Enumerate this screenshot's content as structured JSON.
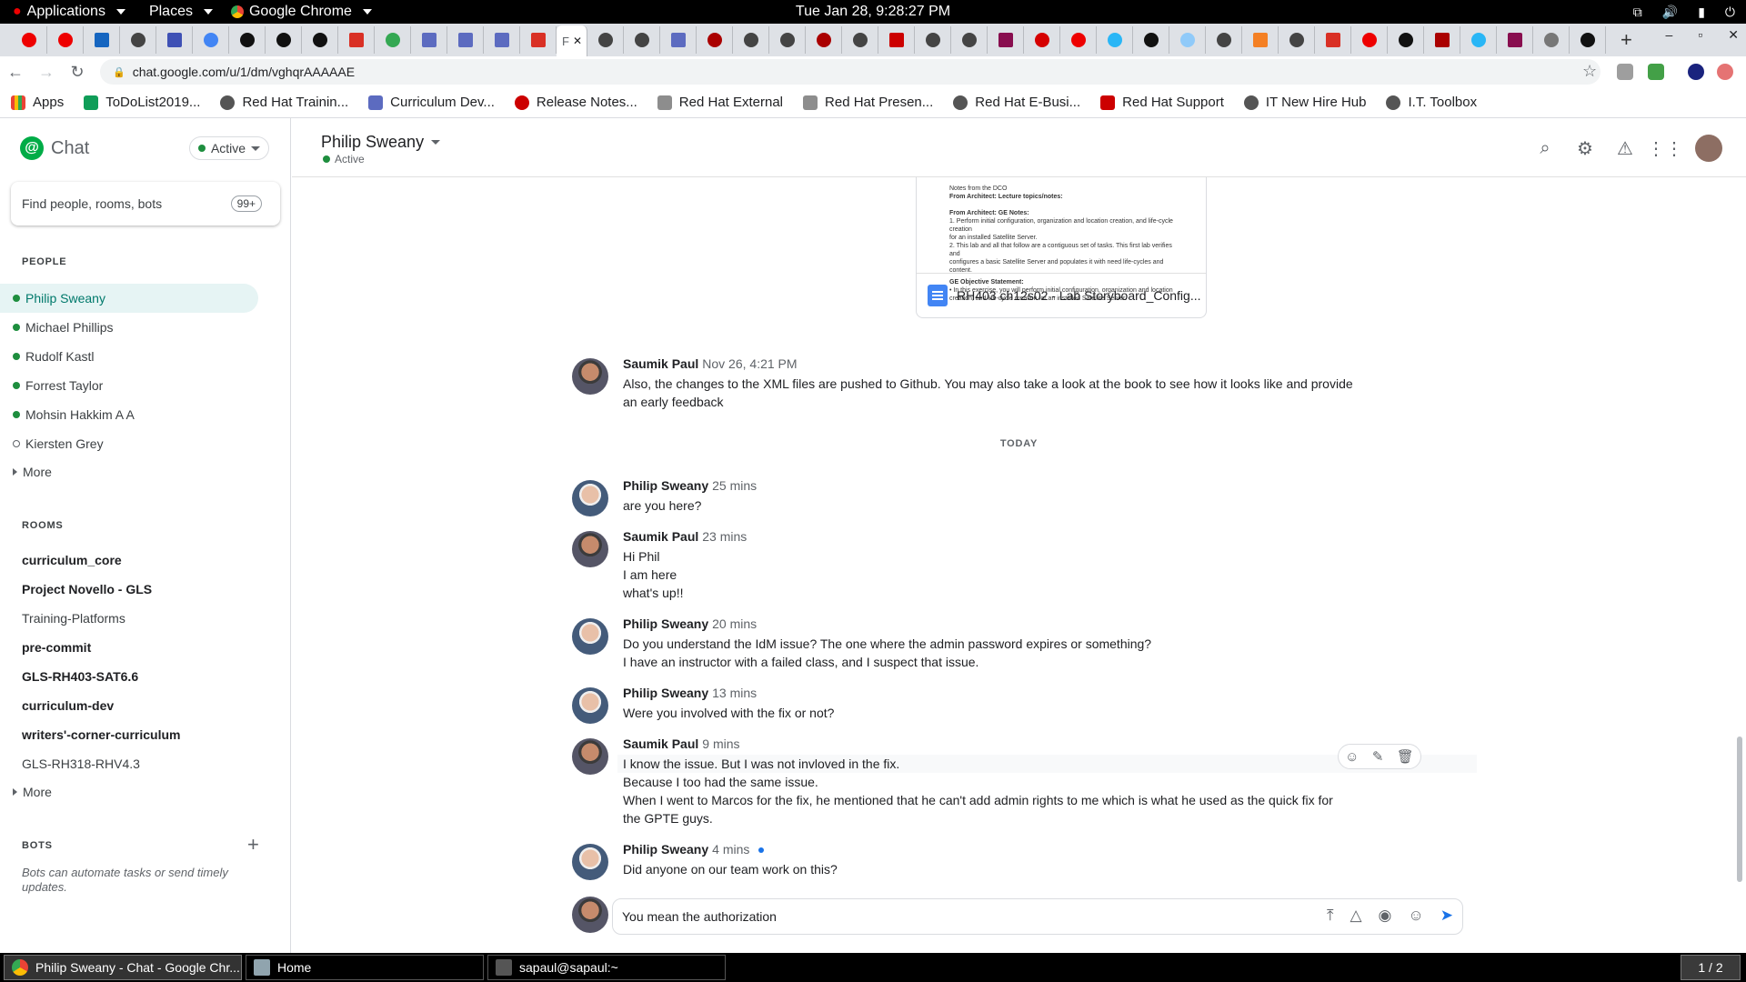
{
  "gnome": {
    "applications": "Applications",
    "places": "Places",
    "browser": "Google Chrome",
    "clock": "Tue Jan 28,  9:28:27 PM"
  },
  "browser": {
    "active_tab_label": "F",
    "url": "chat.google.com/u/1/dm/vghqrAAAAAE",
    "bookmarks": [
      {
        "label": "Apps",
        "color": "#ea4335"
      },
      {
        "label": "ToDoList2019...",
        "color": "#0f9d58"
      },
      {
        "label": "Red Hat Trainin...",
        "color": "#555555"
      },
      {
        "label": "Curriculum Dev...",
        "color": "#5c6bc0"
      },
      {
        "label": "Release Notes...",
        "color": "#cc0000"
      },
      {
        "label": "Red Hat External",
        "color": "#8d8d8d"
      },
      {
        "label": "Red Hat Presen...",
        "color": "#8d8d8d"
      },
      {
        "label": "Red Hat E-Busi...",
        "color": "#555555"
      },
      {
        "label": "Red Hat Support",
        "color": "#cc0000"
      },
      {
        "label": "IT New Hire Hub",
        "color": "#555555"
      },
      {
        "label": "I.T. Toolbox",
        "color": "#555555"
      }
    ]
  },
  "sidebar": {
    "app_name": "Chat",
    "status": "Active",
    "search_placeholder": "Find people, rooms, bots",
    "unread_badge": "99+",
    "people_header": "PEOPLE",
    "people": [
      {
        "name": "Philip Sweany",
        "online": true
      },
      {
        "name": "Michael Phillips",
        "online": true
      },
      {
        "name": "Rudolf Kastl",
        "online": true
      },
      {
        "name": "Forrest Taylor",
        "online": true
      },
      {
        "name": "Mohsin Hakkim A A",
        "online": true
      },
      {
        "name": "Kiersten Grey",
        "online": false
      }
    ],
    "more_people": "More",
    "rooms_header": "ROOMS",
    "rooms": [
      {
        "name": "curriculum_core",
        "unread": true
      },
      {
        "name": "Project Novello - GLS",
        "unread": true
      },
      {
        "name": "Training-Platforms",
        "unread": false
      },
      {
        "name": "pre-commit",
        "unread": true
      },
      {
        "name": "GLS-RH403-SAT6.6",
        "unread": true
      },
      {
        "name": "curriculum-dev",
        "unread": true
      },
      {
        "name": "writers'-corner-curriculum",
        "unread": true
      },
      {
        "name": "GLS-RH318-RHV4.3",
        "unread": false
      }
    ],
    "more_rooms": "More",
    "bots_header": "BOTS",
    "bots_hint": "Bots can automate tasks or send timely updates."
  },
  "conversation": {
    "title": "Philip Sweany",
    "status": "Active",
    "attachment": {
      "name": "RH403 ch12s02 - Lab Storyboard_Config...",
      "preview_lines": [
        "Notes from the DCO",
        "From Architect: Lecture topics/notes:",
        "",
        "From Architect: GE Notes:",
        "1. Perform initial configuration, organization and location creation, and life-cycle creation",
        "   for an installed Satellite Server.",
        "2. This lab and all that follow are a contiguous set of tasks. This first lab verifies and",
        "   configures a basic Satellite Server and populates it with need life-cycles and content.",
        "",
        "GE Objective Statement:",
        "• In this exercise, you will perform initial configuration, organization and location",
        "  creation, and life-cycle creation for an installed Satellite Server."
      ]
    },
    "today_divider": "TODAY",
    "messages": [
      {
        "author": "Saumik Paul",
        "time": "Nov 26, 4:21 PM",
        "lines": [
          "Also, the changes to the XML files are pushed to Github. You may also take a look at the book to see how it looks like and provide",
          "an early feedback"
        ]
      },
      {
        "author": "Philip Sweany",
        "time": "25 mins",
        "lines": [
          "are you here?"
        ]
      },
      {
        "author": "Saumik Paul",
        "time": "23 mins",
        "lines": [
          "Hi Phil",
          "I am here",
          "what's up!!"
        ]
      },
      {
        "author": "Philip Sweany",
        "time": "20 mins",
        "lines": [
          "Do you understand the IdM issue?  The one where the admin password expires or something?",
          "I have an instructor with a failed class, and I suspect that issue."
        ]
      },
      {
        "author": "Philip Sweany",
        "time": "13 mins",
        "lines": [
          "Were you involved with the fix or not?"
        ]
      },
      {
        "author": "Saumik Paul",
        "time": "9 mins",
        "lines": [
          "I know the issue. But I was not invloved in the fix.",
          "Because I too had the same issue.",
          "When I went to Marcos for the fix, he mentioned that he can't add admin rights to me which is what he used as the quick fix for",
          "the GPTE guys."
        ]
      },
      {
        "author": "Philip Sweany",
        "time": "4 mins",
        "lines": [
          "Did anyone on our team work on this?"
        ]
      }
    ],
    "compose_value": "You mean the authorization"
  },
  "taskbar": {
    "items": [
      "Philip Sweany - Chat - Google Chr...",
      "Home",
      "sapaul@sapaul:~"
    ],
    "workspace": "1 / 2"
  },
  "colors": {
    "accent_teal": "#00796b",
    "online_green": "#1e8e3e",
    "send_blue": "#1a73e8"
  }
}
